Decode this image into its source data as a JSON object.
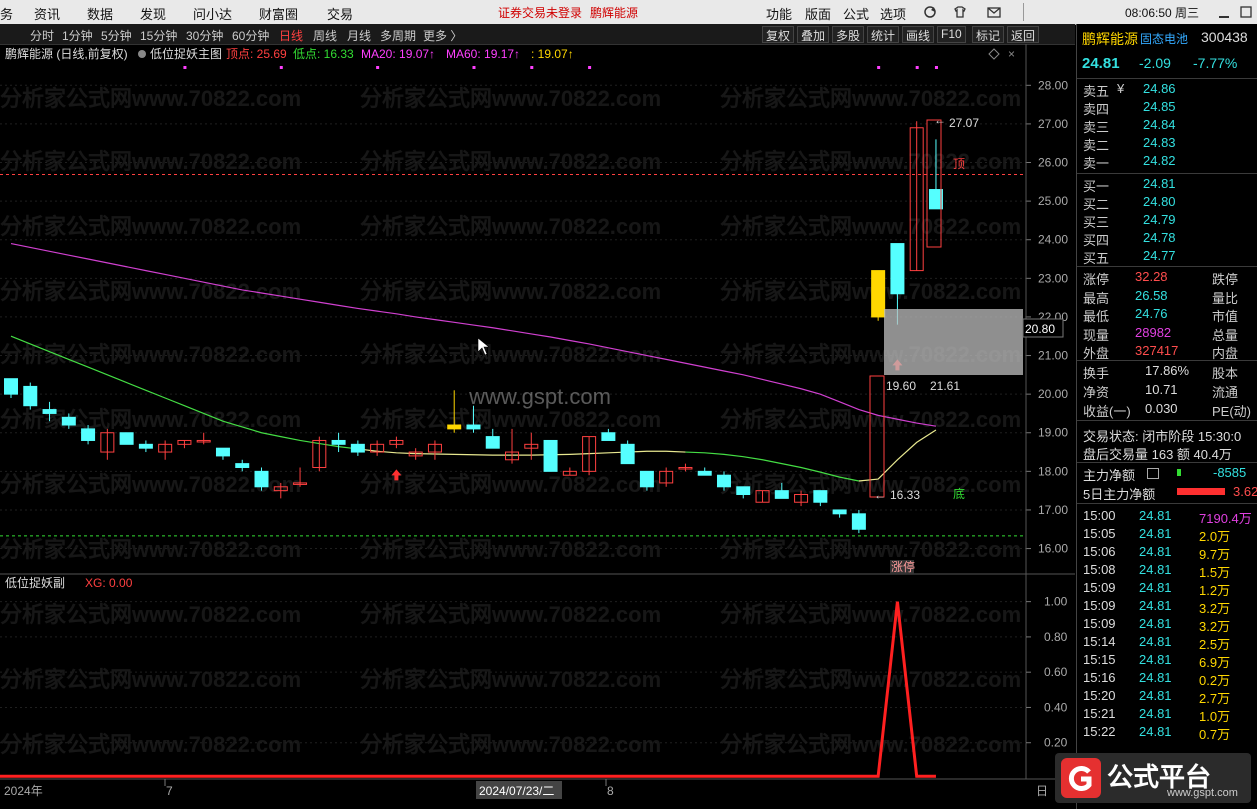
{
  "menu": {
    "items": [
      "务",
      "资讯",
      "数据",
      "发现",
      "问小达",
      "财富圈",
      "交易"
    ],
    "login_warning": "证券交易未登录",
    "stock_name": "鹏辉能源",
    "right_items": [
      "功能",
      "版面",
      "公式",
      "选项"
    ],
    "clock": "08:06:50 周三"
  },
  "periods": {
    "items": [
      "分时",
      "1分钟",
      "5分钟",
      "15分钟",
      "30分钟",
      "60分钟",
      "日线",
      "周线",
      "月线",
      "多周期",
      "更多 〉"
    ],
    "active": "日线",
    "tools": [
      "复权",
      "叠加",
      "多股",
      "统计",
      "画线",
      "F10",
      "标记",
      "返回"
    ]
  },
  "main_panel": {
    "title": "鹏辉能源 (日线,前复权)",
    "indicator": "低位捉妖主图",
    "legend": [
      {
        "label": "顶点: 25.69",
        "color": "#ff4040"
      },
      {
        "label": "低点: 16.33",
        "color": "#33dd33"
      },
      {
        "label": "MA20: 19.07↑",
        "color": "#ff40ff"
      },
      {
        "label": "MA60: 19.17↑",
        "color": "#ff40ff"
      },
      {
        "label": ": 19.07↑",
        "color": "#ffd700"
      }
    ],
    "high_label": "27.07",
    "low_label": "16.33",
    "top_marker": "顶",
    "bottom_marker": "底",
    "limit_up_tag": "涨停",
    "cursor_price": "20.80",
    "box_label_a": "19.60",
    "box_label_b": "21.61",
    "center_wm": "www.gspt.com",
    "watermark": "分析家公式网www.70822.com"
  },
  "sub_panel": {
    "title": "低位捉妖副",
    "value": "XG: 0.00"
  },
  "x_axis": {
    "labels": [
      "2024年",
      "7",
      "2024/07/23/二",
      "8"
    ],
    "end_mark": "日"
  },
  "chart_data": {
    "type": "candlestick",
    "ylim": [
      15.6,
      28.5
    ],
    "y_ticks": [
      "28.00",
      "27.00",
      "26.00",
      "25.00",
      "24.00",
      "23.00",
      "22.00",
      "21.00",
      "20.00",
      "19.00",
      "18.00",
      "17.00",
      "16.00"
    ],
    "y_values": [
      28,
      27,
      26,
      25,
      24,
      23,
      22,
      21,
      20,
      19,
      18,
      17,
      16
    ],
    "ohlc": [
      [
        20.4,
        20.4,
        19.9,
        20.0
      ],
      [
        20.2,
        20.3,
        19.6,
        19.7
      ],
      [
        19.6,
        19.8,
        19.3,
        19.5
      ],
      [
        19.4,
        19.5,
        19.1,
        19.2
      ],
      [
        19.1,
        19.2,
        18.7,
        18.8
      ],
      [
        18.5,
        19.1,
        18.3,
        19.0
      ],
      [
        19.0,
        19.0,
        18.7,
        18.7
      ],
      [
        18.7,
        18.8,
        18.5,
        18.6
      ],
      [
        18.5,
        18.8,
        18.3,
        18.7
      ],
      [
        18.7,
        18.8,
        18.6,
        18.8
      ],
      [
        18.8,
        19.0,
        18.7,
        18.8
      ],
      [
        18.6,
        18.6,
        18.3,
        18.4
      ],
      [
        18.2,
        18.3,
        18.0,
        18.1
      ],
      [
        18.0,
        18.1,
        17.5,
        17.6
      ],
      [
        17.5,
        17.7,
        17.3,
        17.6
      ],
      [
        17.7,
        18.1,
        17.6,
        17.7
      ],
      [
        18.1,
        18.9,
        18.0,
        18.8
      ],
      [
        18.8,
        19.0,
        18.5,
        18.7
      ],
      [
        18.7,
        18.8,
        18.4,
        18.5
      ],
      [
        18.5,
        18.8,
        18.4,
        18.7
      ],
      [
        18.7,
        18.9,
        18.6,
        18.8
      ],
      [
        18.4,
        18.6,
        18.3,
        18.5
      ],
      [
        18.5,
        18.8,
        18.3,
        18.7
      ],
      [
        19.2,
        20.1,
        19.0,
        19.1
      ],
      [
        19.2,
        19.7,
        19.0,
        19.1
      ],
      [
        18.9,
        19.1,
        18.6,
        18.6
      ],
      [
        18.3,
        19.1,
        18.2,
        18.5
      ],
      [
        18.6,
        19.0,
        18.3,
        18.7
      ],
      [
        18.8,
        18.8,
        18.0,
        18.0
      ],
      [
        17.9,
        18.1,
        17.9,
        18.0
      ],
      [
        18.0,
        18.9,
        17.9,
        18.9
      ],
      [
        19.0,
        19.1,
        18.8,
        18.8
      ],
      [
        18.7,
        18.8,
        18.2,
        18.2
      ],
      [
        18.0,
        18.0,
        17.5,
        17.6
      ],
      [
        17.7,
        18.1,
        17.6,
        18.0
      ],
      [
        18.1,
        18.2,
        18.0,
        18.1
      ],
      [
        18.0,
        18.1,
        17.9,
        17.9
      ],
      [
        17.9,
        18.0,
        17.5,
        17.6
      ],
      [
        17.6,
        17.6,
        17.3,
        17.4
      ],
      [
        17.2,
        17.5,
        17.2,
        17.5
      ],
      [
        17.5,
        17.7,
        17.3,
        17.3
      ],
      [
        17.2,
        17.5,
        17.1,
        17.4
      ],
      [
        17.5,
        17.5,
        17.1,
        17.2
      ],
      [
        17.0,
        17.0,
        16.8,
        16.9
      ],
      [
        16.9,
        17.0,
        16.4,
        16.5
      ],
      [
        22.0,
        23.2,
        21.9,
        23.2
      ],
      [
        23.9,
        23.9,
        21.8,
        22.6
      ],
      [
        23.2,
        27.07,
        23.2,
        26.9
      ],
      [
        25.3,
        26.6,
        24.8,
        24.8
      ]
    ],
    "limit_up_index": 45,
    "ma_short": [
      21.5,
      21.3,
      21.1,
      20.9,
      20.7,
      20.5,
      20.3,
      20.1,
      19.9,
      19.7,
      19.5,
      19.3,
      19.15,
      19.0,
      18.9,
      18.8,
      18.72,
      18.64,
      18.58,
      18.52,
      18.48,
      18.46,
      18.45,
      18.44,
      18.43,
      18.42,
      18.42,
      18.42,
      18.43,
      18.44,
      18.46,
      18.48,
      18.5,
      18.52,
      18.52,
      18.5,
      18.48,
      18.44,
      18.38,
      18.3,
      18.2,
      18.1,
      17.98,
      17.85,
      17.75,
      17.8,
      18.3,
      18.75,
      19.07
    ],
    "ma_long": [
      23.9,
      23.8,
      23.7,
      23.6,
      23.5,
      23.4,
      23.3,
      23.2,
      23.1,
      23.0,
      22.9,
      22.8,
      22.7,
      22.62,
      22.54,
      22.46,
      22.38,
      22.3,
      22.22,
      22.15,
      22.08,
      22.0,
      21.93,
      21.86,
      21.79,
      21.72,
      21.64,
      21.56,
      21.48,
      21.39,
      21.3,
      21.2,
      21.1,
      21.0,
      20.9,
      20.8,
      20.7,
      20.6,
      20.5,
      20.38,
      20.26,
      20.14,
      20.0,
      19.8,
      19.6,
      19.45,
      19.35,
      19.25,
      19.17
    ],
    "top_line": 25.69,
    "bottom_line": 16.33,
    "buy_arrows": [
      20,
      46
    ],
    "sub": {
      "ylim": [
        0,
        1.1
      ],
      "y_values": [
        1.0,
        0.8,
        0.6,
        0.4,
        0.2
      ],
      "y_ticks": [
        "1.00",
        "0.80",
        "0.60",
        "0.40",
        "0.20"
      ],
      "signal_index": 46
    }
  },
  "side": {
    "name": "鹏辉能源",
    "concept": "固态电池",
    "code": "300438",
    "price": "24.81",
    "change": "-2.09",
    "pct": "-7.77%",
    "asks": [
      {
        "label": "卖五",
        "price": "24.86"
      },
      {
        "label": "卖四",
        "price": "24.85"
      },
      {
        "label": "卖三",
        "price": "24.84"
      },
      {
        "label": "卖二",
        "price": "24.83"
      },
      {
        "label": "卖一",
        "price": "24.82"
      }
    ],
    "bids": [
      {
        "label": "买一",
        "price": "24.81"
      },
      {
        "label": "买二",
        "price": "24.80"
      },
      {
        "label": "买三",
        "price": "24.79"
      },
      {
        "label": "买四",
        "price": "24.78"
      },
      {
        "label": "买五",
        "price": "24.77"
      }
    ],
    "stats": [
      {
        "l": "涨停",
        "v": "32.28",
        "c": "up",
        "r": "跌停"
      },
      {
        "l": "最高",
        "v": "26.58",
        "c": "dn",
        "r": "量比"
      },
      {
        "l": "最低",
        "v": "24.76",
        "c": "dn",
        "r": "市值"
      },
      {
        "l": "现量",
        "v": "28982",
        "c": "mg",
        "r": "总量"
      },
      {
        "l": "外盘",
        "v": "327417",
        "c": "up",
        "r": "内盘"
      }
    ],
    "stats2": [
      {
        "l": "换手",
        "v": "17.86%",
        "r": "股本"
      },
      {
        "l": "净资",
        "v": "10.71",
        "r": "流通"
      },
      {
        "l": "收益(一)",
        "v": "0.030",
        "r": "PE(动)"
      }
    ],
    "trade_status": "交易状态: 闭市阶段 15:30:0",
    "after_hours": "盘后交易量 163 额 40.4万",
    "main_flow_label": "主力净额",
    "main_flow_value": "-8585",
    "five_day_label": "5日主力净额",
    "five_day_value": "3.62",
    "ticks": [
      {
        "t": "15:00",
        "p": "24.81",
        "v": "7190.4万"
      },
      {
        "t": "15:05",
        "p": "24.81",
        "v": "2.0万"
      },
      {
        "t": "15:06",
        "p": "24.81",
        "v": "9.7万"
      },
      {
        "t": "15:08",
        "p": "24.81",
        "v": "1.5万"
      },
      {
        "t": "15:09",
        "p": "24.81",
        "v": "1.2万"
      },
      {
        "t": "15:09",
        "p": "24.81",
        "v": "3.2万"
      },
      {
        "t": "15:09",
        "p": "24.81",
        "v": "3.2万"
      },
      {
        "t": "15:14",
        "p": "24.81",
        "v": "2.5万"
      },
      {
        "t": "15:15",
        "p": "24.81",
        "v": "6.9万"
      },
      {
        "t": "15:16",
        "p": "24.81",
        "v": "0.2万"
      },
      {
        "t": "15:20",
        "p": "24.81",
        "v": "2.7万"
      },
      {
        "t": "15:21",
        "p": "24.81",
        "v": "1.0万"
      },
      {
        "t": "15:22",
        "p": "24.81",
        "v": "0.7万"
      }
    ],
    "logo_text": "公式平台",
    "logo_url": "www.gspt.com"
  }
}
